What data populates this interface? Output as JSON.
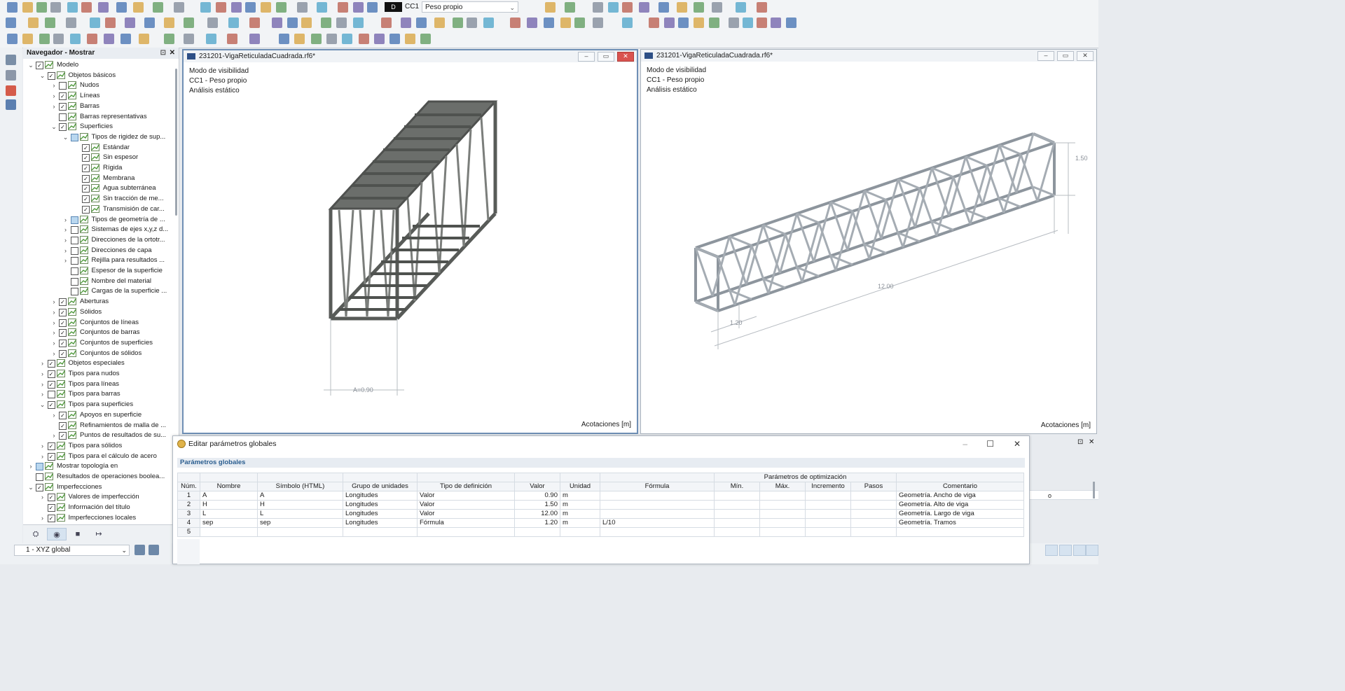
{
  "toolbar": {
    "load_case_code": "CC1",
    "load_case_type": "D",
    "load_case_name": "Peso propio"
  },
  "navigator": {
    "title": "Navegador - Mostrar",
    "items": [
      {
        "level": 0,
        "exp": "v",
        "check": "y",
        "label": "Modelo"
      },
      {
        "level": 1,
        "exp": "v",
        "check": "y",
        "label": "Objetos básicos"
      },
      {
        "level": 2,
        "exp": ">",
        "check": "n",
        "label": "Nudos"
      },
      {
        "level": 2,
        "exp": ">",
        "check": "y",
        "label": "Líneas"
      },
      {
        "level": 2,
        "exp": ">",
        "check": "y",
        "label": "Barras"
      },
      {
        "level": 2,
        "exp": "",
        "check": "n",
        "label": "Barras representativas"
      },
      {
        "level": 2,
        "exp": "v",
        "check": "y",
        "label": "Superficies"
      },
      {
        "level": 3,
        "exp": "v",
        "check": "p",
        "label": "Tipos de rigidez de sup..."
      },
      {
        "level": 4,
        "exp": "",
        "check": "y",
        "label": "Estándar"
      },
      {
        "level": 4,
        "exp": "",
        "check": "y",
        "label": "Sin espesor"
      },
      {
        "level": 4,
        "exp": "",
        "check": "y",
        "label": "Rígida"
      },
      {
        "level": 4,
        "exp": "",
        "check": "y",
        "label": "Membrana"
      },
      {
        "level": 4,
        "exp": "",
        "check": "y",
        "label": "Agua subterránea"
      },
      {
        "level": 4,
        "exp": "",
        "check": "y",
        "label": "Sin tracción de me..."
      },
      {
        "level": 4,
        "exp": "",
        "check": "y",
        "label": "Transmisión de car..."
      },
      {
        "level": 3,
        "exp": ">",
        "check": "p",
        "label": "Tipos de geometría de ..."
      },
      {
        "level": 3,
        "exp": ">",
        "check": "n",
        "label": "Sistemas de ejes x,y,z d..."
      },
      {
        "level": 3,
        "exp": ">",
        "check": "n",
        "label": "Direcciones de la ortotr..."
      },
      {
        "level": 3,
        "exp": ">",
        "check": "n",
        "label": "Direcciones de capa"
      },
      {
        "level": 3,
        "exp": ">",
        "check": "n",
        "label": "Rejilla para resultados ..."
      },
      {
        "level": 3,
        "exp": "",
        "check": "n",
        "label": "Espesor de la superficie"
      },
      {
        "level": 3,
        "exp": "",
        "check": "n",
        "label": "Nombre del material"
      },
      {
        "level": 3,
        "exp": "",
        "check": "n",
        "label": "Cargas de la superficie ..."
      },
      {
        "level": 2,
        "exp": ">",
        "check": "y",
        "label": "Aberturas"
      },
      {
        "level": 2,
        "exp": ">",
        "check": "y",
        "label": "Sólidos"
      },
      {
        "level": 2,
        "exp": ">",
        "check": "y",
        "label": "Conjuntos de líneas"
      },
      {
        "level": 2,
        "exp": ">",
        "check": "y",
        "label": "Conjuntos de barras"
      },
      {
        "level": 2,
        "exp": ">",
        "check": "y",
        "label": "Conjuntos de superficies"
      },
      {
        "level": 2,
        "exp": ">",
        "check": "y",
        "label": "Conjuntos de sólidos"
      },
      {
        "level": 1,
        "exp": ">",
        "check": "y",
        "label": "Objetos especiales"
      },
      {
        "level": 1,
        "exp": ">",
        "check": "y",
        "label": "Tipos para nudos"
      },
      {
        "level": 1,
        "exp": ">",
        "check": "y",
        "label": "Tipos para líneas"
      },
      {
        "level": 1,
        "exp": ">",
        "check": "n",
        "label": "Tipos para barras"
      },
      {
        "level": 1,
        "exp": "v",
        "check": "y",
        "label": "Tipos para superficies"
      },
      {
        "level": 2,
        "exp": ">",
        "check": "y",
        "label": "Apoyos en superficie"
      },
      {
        "level": 2,
        "exp": "",
        "check": "y",
        "label": "Refinamientos de malla de ..."
      },
      {
        "level": 2,
        "exp": ">",
        "check": "y",
        "label": "Puntos de resultados de su..."
      },
      {
        "level": 1,
        "exp": ">",
        "check": "y",
        "label": "Tipos para sólidos"
      },
      {
        "level": 1,
        "exp": ">",
        "check": "y",
        "label": "Tipos para el cálculo de acero"
      },
      {
        "level": 0,
        "exp": ">",
        "check": "p",
        "label": "Mostrar topología en"
      },
      {
        "level": 0,
        "exp": "",
        "check": "n",
        "label": "Resultados de operaciones boolea..."
      },
      {
        "level": 0,
        "exp": "v",
        "check": "y",
        "label": "Imperfecciones"
      },
      {
        "level": 1,
        "exp": ">",
        "check": "y",
        "label": "Valores de imperfección"
      },
      {
        "level": 1,
        "exp": "",
        "check": "y",
        "label": "Información del título"
      },
      {
        "level": 1,
        "exp": ">",
        "check": "y",
        "label": "Imperfecciones locales"
      }
    ]
  },
  "status": {
    "coord_system": "1 - XYZ global"
  },
  "view_left": {
    "title": "231201-VigaReticuladaCuadrada.rf6*",
    "overlay": [
      "Modo de visibilidad",
      "CC1 - Peso propio",
      "Análisis estático"
    ],
    "dim_label": "A=0.90",
    "footer": "Acotaciones [m]"
  },
  "view_right": {
    "title": "231201-VigaReticuladaCuadrada.rf6*",
    "overlay": [
      "Modo de visibilidad",
      "CC1 - Peso propio",
      "Análisis estático"
    ],
    "dim_height": "1.50",
    "dim_length": "12.00",
    "dim_sep": "1.20",
    "footer": "Acotaciones [m]"
  },
  "dialog": {
    "title": "Editar parámetros globales",
    "group": "Parámetros globales",
    "opt_header": "Parámetros de optimización",
    "columns": [
      "Núm.",
      "Nombre",
      "Símbolo (HTML)",
      "Grupo de unidades",
      "Tipo de definición",
      "Valor",
      "Unidad",
      "Fórmula",
      "Mín.",
      "Máx.",
      "Incremento",
      "Pasos",
      "Comentario"
    ],
    "rows": [
      [
        "1",
        "A",
        "A",
        "Longitudes",
        "Valor",
        "0.90",
        "m",
        "",
        "",
        "",
        "",
        "",
        "Geometría. Ancho de viga"
      ],
      [
        "2",
        "H",
        "H",
        "Longitudes",
        "Valor",
        "1.50",
        "m",
        "",
        "",
        "",
        "",
        "",
        "Geometría. Alto de viga"
      ],
      [
        "3",
        "L",
        "L",
        "Longitudes",
        "Valor",
        "12.00",
        "m",
        "",
        "",
        "",
        "",
        "",
        "Geometría. Largo de viga"
      ],
      [
        "4",
        "sep",
        "sep",
        "Longitudes",
        "Fórmula",
        "1.20",
        "m",
        "L/10",
        "",
        "",
        "",
        "",
        "Geometría. Tramos"
      ],
      [
        "5",
        "",
        "",
        "",
        "",
        "",
        "",
        "",
        "",
        "",
        "",
        "",
        ""
      ]
    ]
  },
  "background_panel": {
    "partial_text": "o"
  },
  "colors": {
    "accent": "#2d4f86",
    "truss_dark": "#5c5f5c",
    "truss_light": "#9aa3ab",
    "group_text": "#2a5d8f"
  }
}
